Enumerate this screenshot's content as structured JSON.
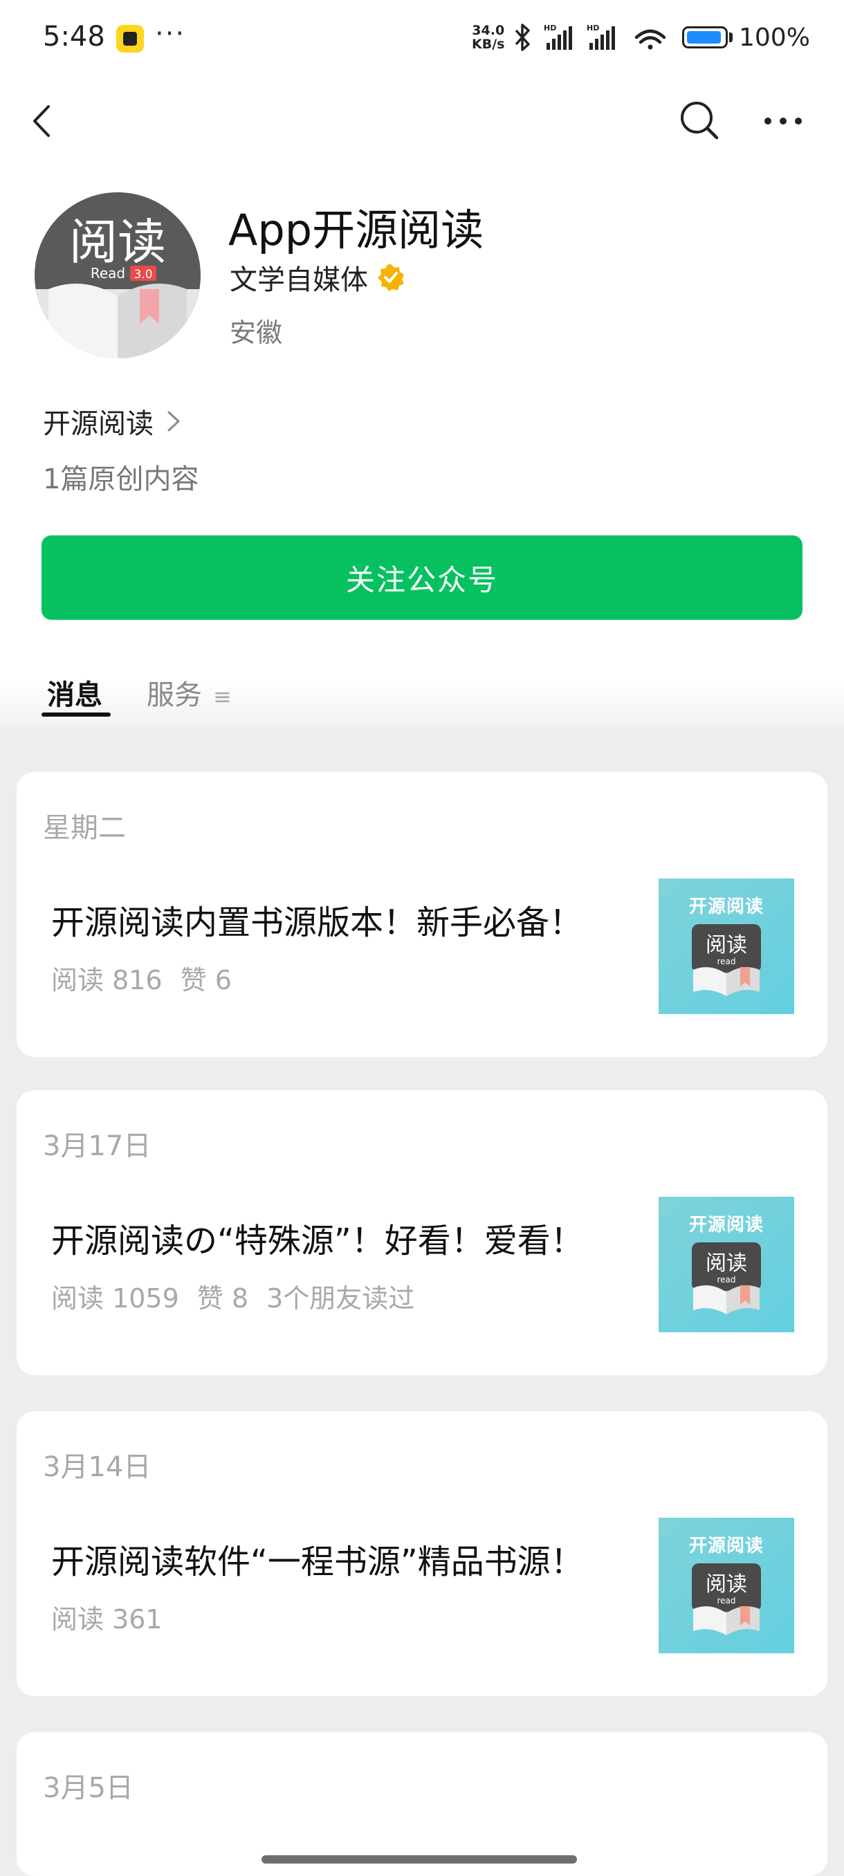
{
  "status_bar": {
    "time": "5:48",
    "more": "···",
    "net_speed": "34.0",
    "net_unit": "KB/s",
    "battery_text": "100%",
    "battery_level": 0.95
  },
  "nav": {
    "back_icon": "chevron-left-icon",
    "search_icon": "search-icon",
    "more_icon": "more-horizontal-icon"
  },
  "profile": {
    "name": "App开源阅读",
    "type": "文学自媒体",
    "region": "安徽",
    "link_label": "开源阅读",
    "original_count": "1篇原创内容",
    "avatar_text": "阅读",
    "avatar_sub": "Read",
    "avatar_version": "3.0"
  },
  "follow_button": "关注公众号",
  "tabs": [
    {
      "label": "消息",
      "active": true
    },
    {
      "label": "服务",
      "active": false
    }
  ],
  "thumb": {
    "title": "开源阅读",
    "book_text": "阅读",
    "book_sub": "read"
  },
  "articles": [
    {
      "date": "星期二",
      "title": "开源阅读内置书源版本！新手必备！",
      "reads": "阅读 816",
      "likes": "赞 6",
      "friends": ""
    },
    {
      "date": "3月17日",
      "title": "开源阅读の“特殊源”！好看！爱看！",
      "reads": "阅读 1059",
      "likes": "赞 8",
      "friends": "3个朋友读过"
    },
    {
      "date": "3月14日",
      "title": "开源阅读软件“一程书源”精品书源！",
      "reads": "阅读 361",
      "likes": "",
      "friends": ""
    },
    {
      "date": "3月5日",
      "title": "",
      "reads": "",
      "likes": "",
      "friends": ""
    }
  ],
  "colors": {
    "accent": "#07c160",
    "verified": "#f5b400",
    "page_bg": "#ededed"
  }
}
